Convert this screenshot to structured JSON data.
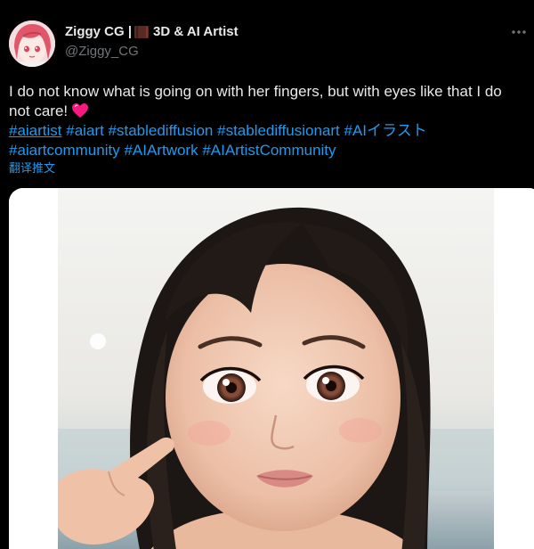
{
  "author": {
    "display_name": "Ziggy CG |",
    "display_name_suffix": "3D & AI Artist",
    "handle": "@Ziggy_CG",
    "book_emoji": "book-icon"
  },
  "tweet": {
    "text": "I do not know what is going on with her fingers, but with eyes like that I do not care!",
    "emoji": "heart-icon",
    "hashtags": [
      "#aiartist",
      "#aiart",
      "#stablediffusion",
      "#stablediffusionart",
      "#AIイラスト",
      "#aiartcommunity",
      "#AIArtwork",
      "#AIArtistCommunity"
    ],
    "translate_label": "翻译推文"
  },
  "colors": {
    "background": "#000000",
    "text": "#e7e9ea",
    "secondary_text": "#71767b",
    "link": "#1d9bf0",
    "heart": "#f91880"
  },
  "media": {
    "type": "photo",
    "icon": "image-icon"
  }
}
